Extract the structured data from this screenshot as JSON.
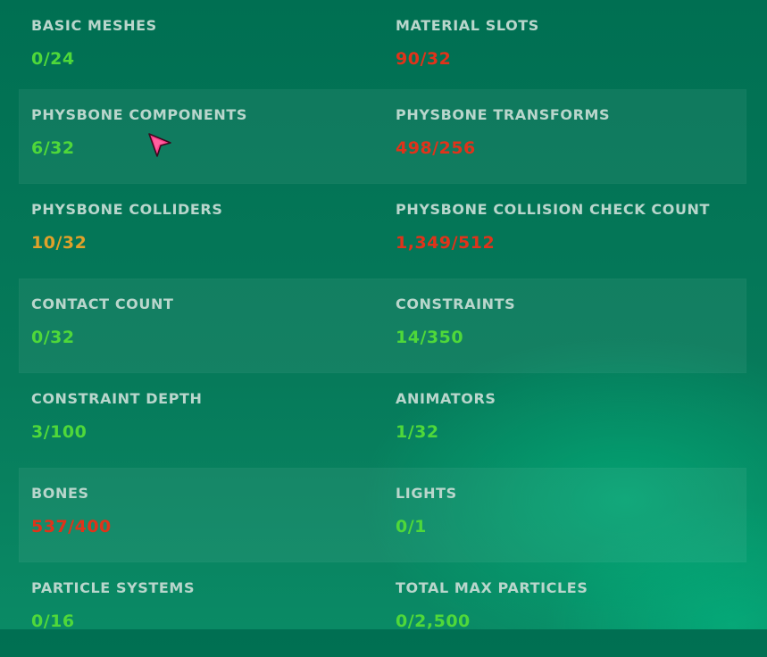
{
  "stats": [
    {
      "left": {
        "label": "BASIC MESHES",
        "value": "0/24",
        "status": "ok"
      },
      "right": {
        "label": "MATERIAL SLOTS",
        "value": "90/32",
        "status": "bad"
      }
    },
    {
      "left": {
        "label": "PHYSBONE COMPONENTS",
        "value": "6/32",
        "status": "ok"
      },
      "right": {
        "label": "PHYSBONE TRANSFORMS",
        "value": "498/256",
        "status": "bad"
      }
    },
    {
      "left": {
        "label": "PHYSBONE COLLIDERS",
        "value": "10/32",
        "status": "warn"
      },
      "right": {
        "label": "PHYSBONE COLLISION CHECK COUNT",
        "value": "1,349/512",
        "status": "bad"
      }
    },
    {
      "left": {
        "label": "CONTACT COUNT",
        "value": "0/32",
        "status": "ok"
      },
      "right": {
        "label": "CONSTRAINTS",
        "value": "14/350",
        "status": "ok"
      }
    },
    {
      "left": {
        "label": "CONSTRAINT DEPTH",
        "value": "3/100",
        "status": "ok"
      },
      "right": {
        "label": "ANIMATORS",
        "value": "1/32",
        "status": "ok"
      }
    },
    {
      "left": {
        "label": "BONES",
        "value": "537/400",
        "status": "bad"
      },
      "right": {
        "label": "LIGHTS",
        "value": "0/1",
        "status": "ok"
      }
    },
    {
      "left": {
        "label": "PARTICLE SYSTEMS",
        "value": "0/16",
        "status": "ok"
      },
      "right": {
        "label": "TOTAL MAX PARTICLES",
        "value": "0/2,500",
        "status": "ok"
      }
    }
  ],
  "colors": {
    "ok": "#4fd83a",
    "warn": "#e0a12a",
    "bad": "#e0331a",
    "label": "#b9d6cc",
    "background": "#006f52",
    "cursor": "#ff3d8a"
  },
  "cursor_icon": "pointer-cursor-icon"
}
